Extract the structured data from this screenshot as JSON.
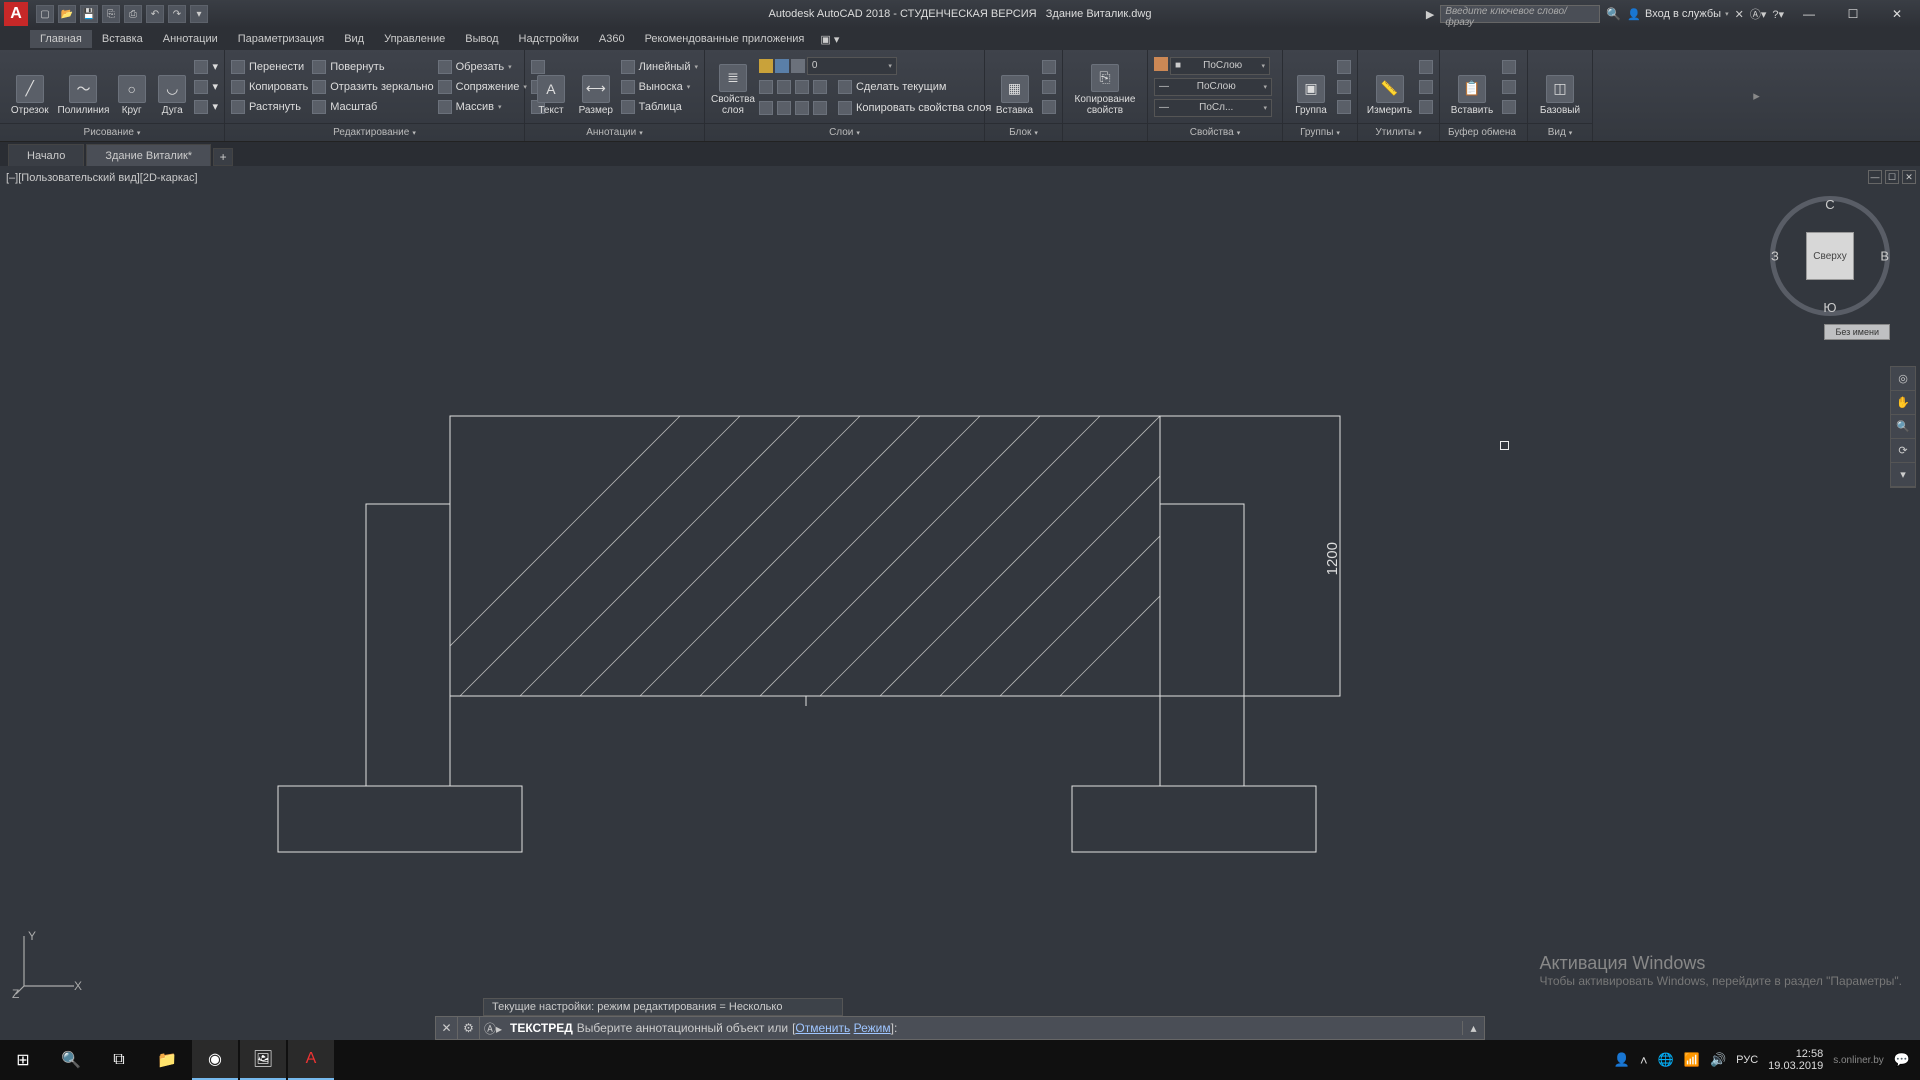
{
  "title": {
    "app": "Autodesk AutoCAD 2018 - СТУДЕНЧЕСКАЯ ВЕРСИЯ",
    "file": "Здание Виталик.dwg"
  },
  "search": {
    "placeholder": "Введите ключевое слово/фразу"
  },
  "signin": {
    "label": "Вход в службы",
    "arrow": "▾"
  },
  "menu": {
    "items": [
      "Главная",
      "Вставка",
      "Аннотации",
      "Параметризация",
      "Вид",
      "Управление",
      "Вывод",
      "Надстройки",
      "A360",
      "Рекомендованные приложения"
    ],
    "active": 0
  },
  "ribbon": {
    "draw": {
      "title": "Рисование",
      "line": "Отрезок",
      "pline": "Полилиния",
      "circle": "Круг",
      "arc": "Дуга"
    },
    "edit": {
      "title": "Редактирование",
      "move": "Перенести",
      "rotate": "Повернуть",
      "trim": "Обрезать",
      "copy": "Копировать",
      "mirror": "Отразить зеркально",
      "fillet": "Сопряжение",
      "stretch": "Растянуть",
      "scale": "Масштаб",
      "array": "Массив"
    },
    "annot": {
      "title": "Аннотации",
      "text": "Текст",
      "dim": "Размер",
      "linear": "Линейный",
      "leader": "Выноска",
      "table": "Таблица"
    },
    "layers": {
      "title": "Слои",
      "props": "Свойства\nслоя",
      "cur": "Сделать текущим",
      "copy": "Копировать свойства слоя",
      "value": "0"
    },
    "block": {
      "title": "Блок",
      "insert": "Вставка",
      "editprops": "Копирование\nсвойств"
    },
    "props": {
      "title": "Свойства",
      "bylayer": "ПоСлою",
      "bylayer2": "ПоСлою",
      "bylayer3": "ПоСл..."
    },
    "groups": {
      "title": "Группы",
      "group": "Группа"
    },
    "util": {
      "title": "Утилиты",
      "measure": "Измерить"
    },
    "clip": {
      "title": "Буфер обмена",
      "paste": "Вставить"
    },
    "view": {
      "title": "Вид",
      "base": "Базовый"
    }
  },
  "tabs": {
    "home": "Начало",
    "doc": "Здание Виталик*"
  },
  "viewport": {
    "label": "[–][Пользовательский вид][2D-каркас]"
  },
  "viewcube": {
    "top": "Сверху",
    "name": "Без имени",
    "n": "С",
    "s": "Ю",
    "e": "В",
    "w": "З"
  },
  "dim": {
    "v1200": "1200"
  },
  "watermark": {
    "l1": "Активация Windows",
    "l2": "Чтобы активировать Windows, перейдите в раздел \"Параметры\"."
  },
  "cmd": {
    "history": "Текущие настройки: режим редактирования = Несколько",
    "prefix": "ТЕКСТРЕД",
    "body": "Выберите аннотационный объект или",
    "opt1": "Отменить",
    "opt2": "Режим",
    "tail": ":"
  },
  "tray": {
    "lang": "РУС",
    "time": "12:58",
    "date": "19.03.2019",
    "site": "s.onliner.by"
  },
  "ucs": {
    "y": "Y",
    "x": "X",
    "z": "Z"
  }
}
